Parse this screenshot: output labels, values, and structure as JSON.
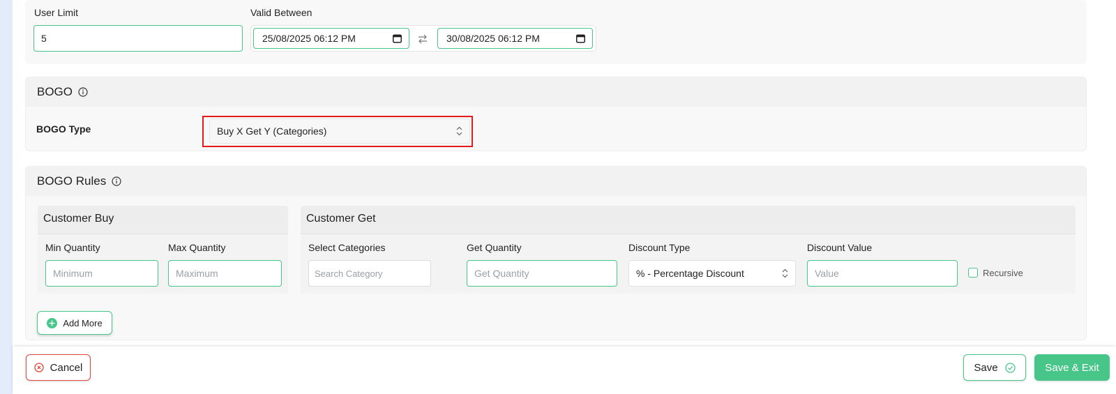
{
  "top": {
    "user_limit_label": "User Limit",
    "user_limit_value": "5",
    "valid_between_label": "Valid Between",
    "start_datetime": "25/08/2025 06:12 PM",
    "end_datetime": "30/08/2025 06:12 PM"
  },
  "bogo": {
    "title": "BOGO",
    "type_label": "BOGO Type",
    "type_value": "Buy X Get Y (Categories)"
  },
  "rules": {
    "title": "BOGO Rules",
    "customer_buy": {
      "title": "Customer Buy",
      "min_label": "Min Quantity",
      "min_placeholder": "Minimum",
      "max_label": "Max Quantity",
      "max_placeholder": "Maximum"
    },
    "customer_get": {
      "title": "Customer Get",
      "categories_label": "Select Categories",
      "categories_placeholder": "Search Category",
      "quantity_label": "Get Quantity",
      "quantity_placeholder": "Get Quantity",
      "discount_type_label": "Discount Type",
      "discount_type_value": "% - Percentage Discount",
      "discount_value_label": "Discount Value",
      "discount_value_placeholder": "Value",
      "recursive_label": "Recursive"
    },
    "add_more_label": "Add More"
  },
  "footer": {
    "cancel_label": "Cancel",
    "save_label": "Save",
    "save_exit_label": "Save & Exit"
  },
  "colors": {
    "accent_green": "#48c689",
    "danger_red": "#e0463c",
    "highlight_red": "#e31b1b"
  }
}
